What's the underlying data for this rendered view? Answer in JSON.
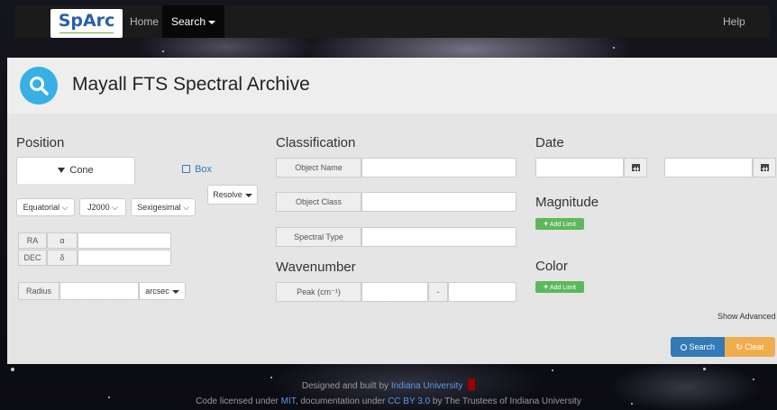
{
  "navbar": {
    "brand": "SpArc",
    "home": "Home",
    "search": "Search",
    "help": "Help"
  },
  "page": {
    "title": "Mayall FTS Spectral Archive"
  },
  "position": {
    "title": "Position",
    "tab_cone": "Cone",
    "tab_box": "Box",
    "resolve": "Resolve",
    "coord_system": "Equatorial",
    "epoch": "J2000",
    "format": "Sexigesimal",
    "ra_label": "RA",
    "ra_symbol": "α",
    "dec_label": "DEC",
    "dec_symbol": "δ",
    "radius_label": "Radius",
    "radius_unit": "arcsec"
  },
  "classification": {
    "title": "Classification",
    "object_name": "Object Name",
    "object_class": "Object Class",
    "spectral_type": "Spectral Type"
  },
  "wavenumber": {
    "title": "Wavenumber",
    "peak_label": "Peak (cm⁻¹)",
    "separator": "-"
  },
  "date": {
    "title": "Date"
  },
  "magnitude": {
    "title": "Magnitude",
    "add_limit": "Add Limit"
  },
  "color": {
    "title": "Color",
    "add_limit": "Add Limit"
  },
  "actions": {
    "show_advanced": "Show Advanced",
    "search": "Search",
    "clear": "Clear"
  },
  "footer": {
    "line1_prefix": "Designed and built by",
    "line1_link": "Indiana University",
    "line2_a": "Code licensed under",
    "line2_mit": "MIT",
    "line2_b": ", documentation under",
    "line2_cc": "CC BY 3.0",
    "line2_c": "by The Trustees of Indiana University"
  },
  "colors": {
    "accent": "#37b0e4",
    "primary": "#337ab7",
    "warning": "#f0ad4e",
    "success": "#5cb85c",
    "iu_red": "#990000"
  }
}
